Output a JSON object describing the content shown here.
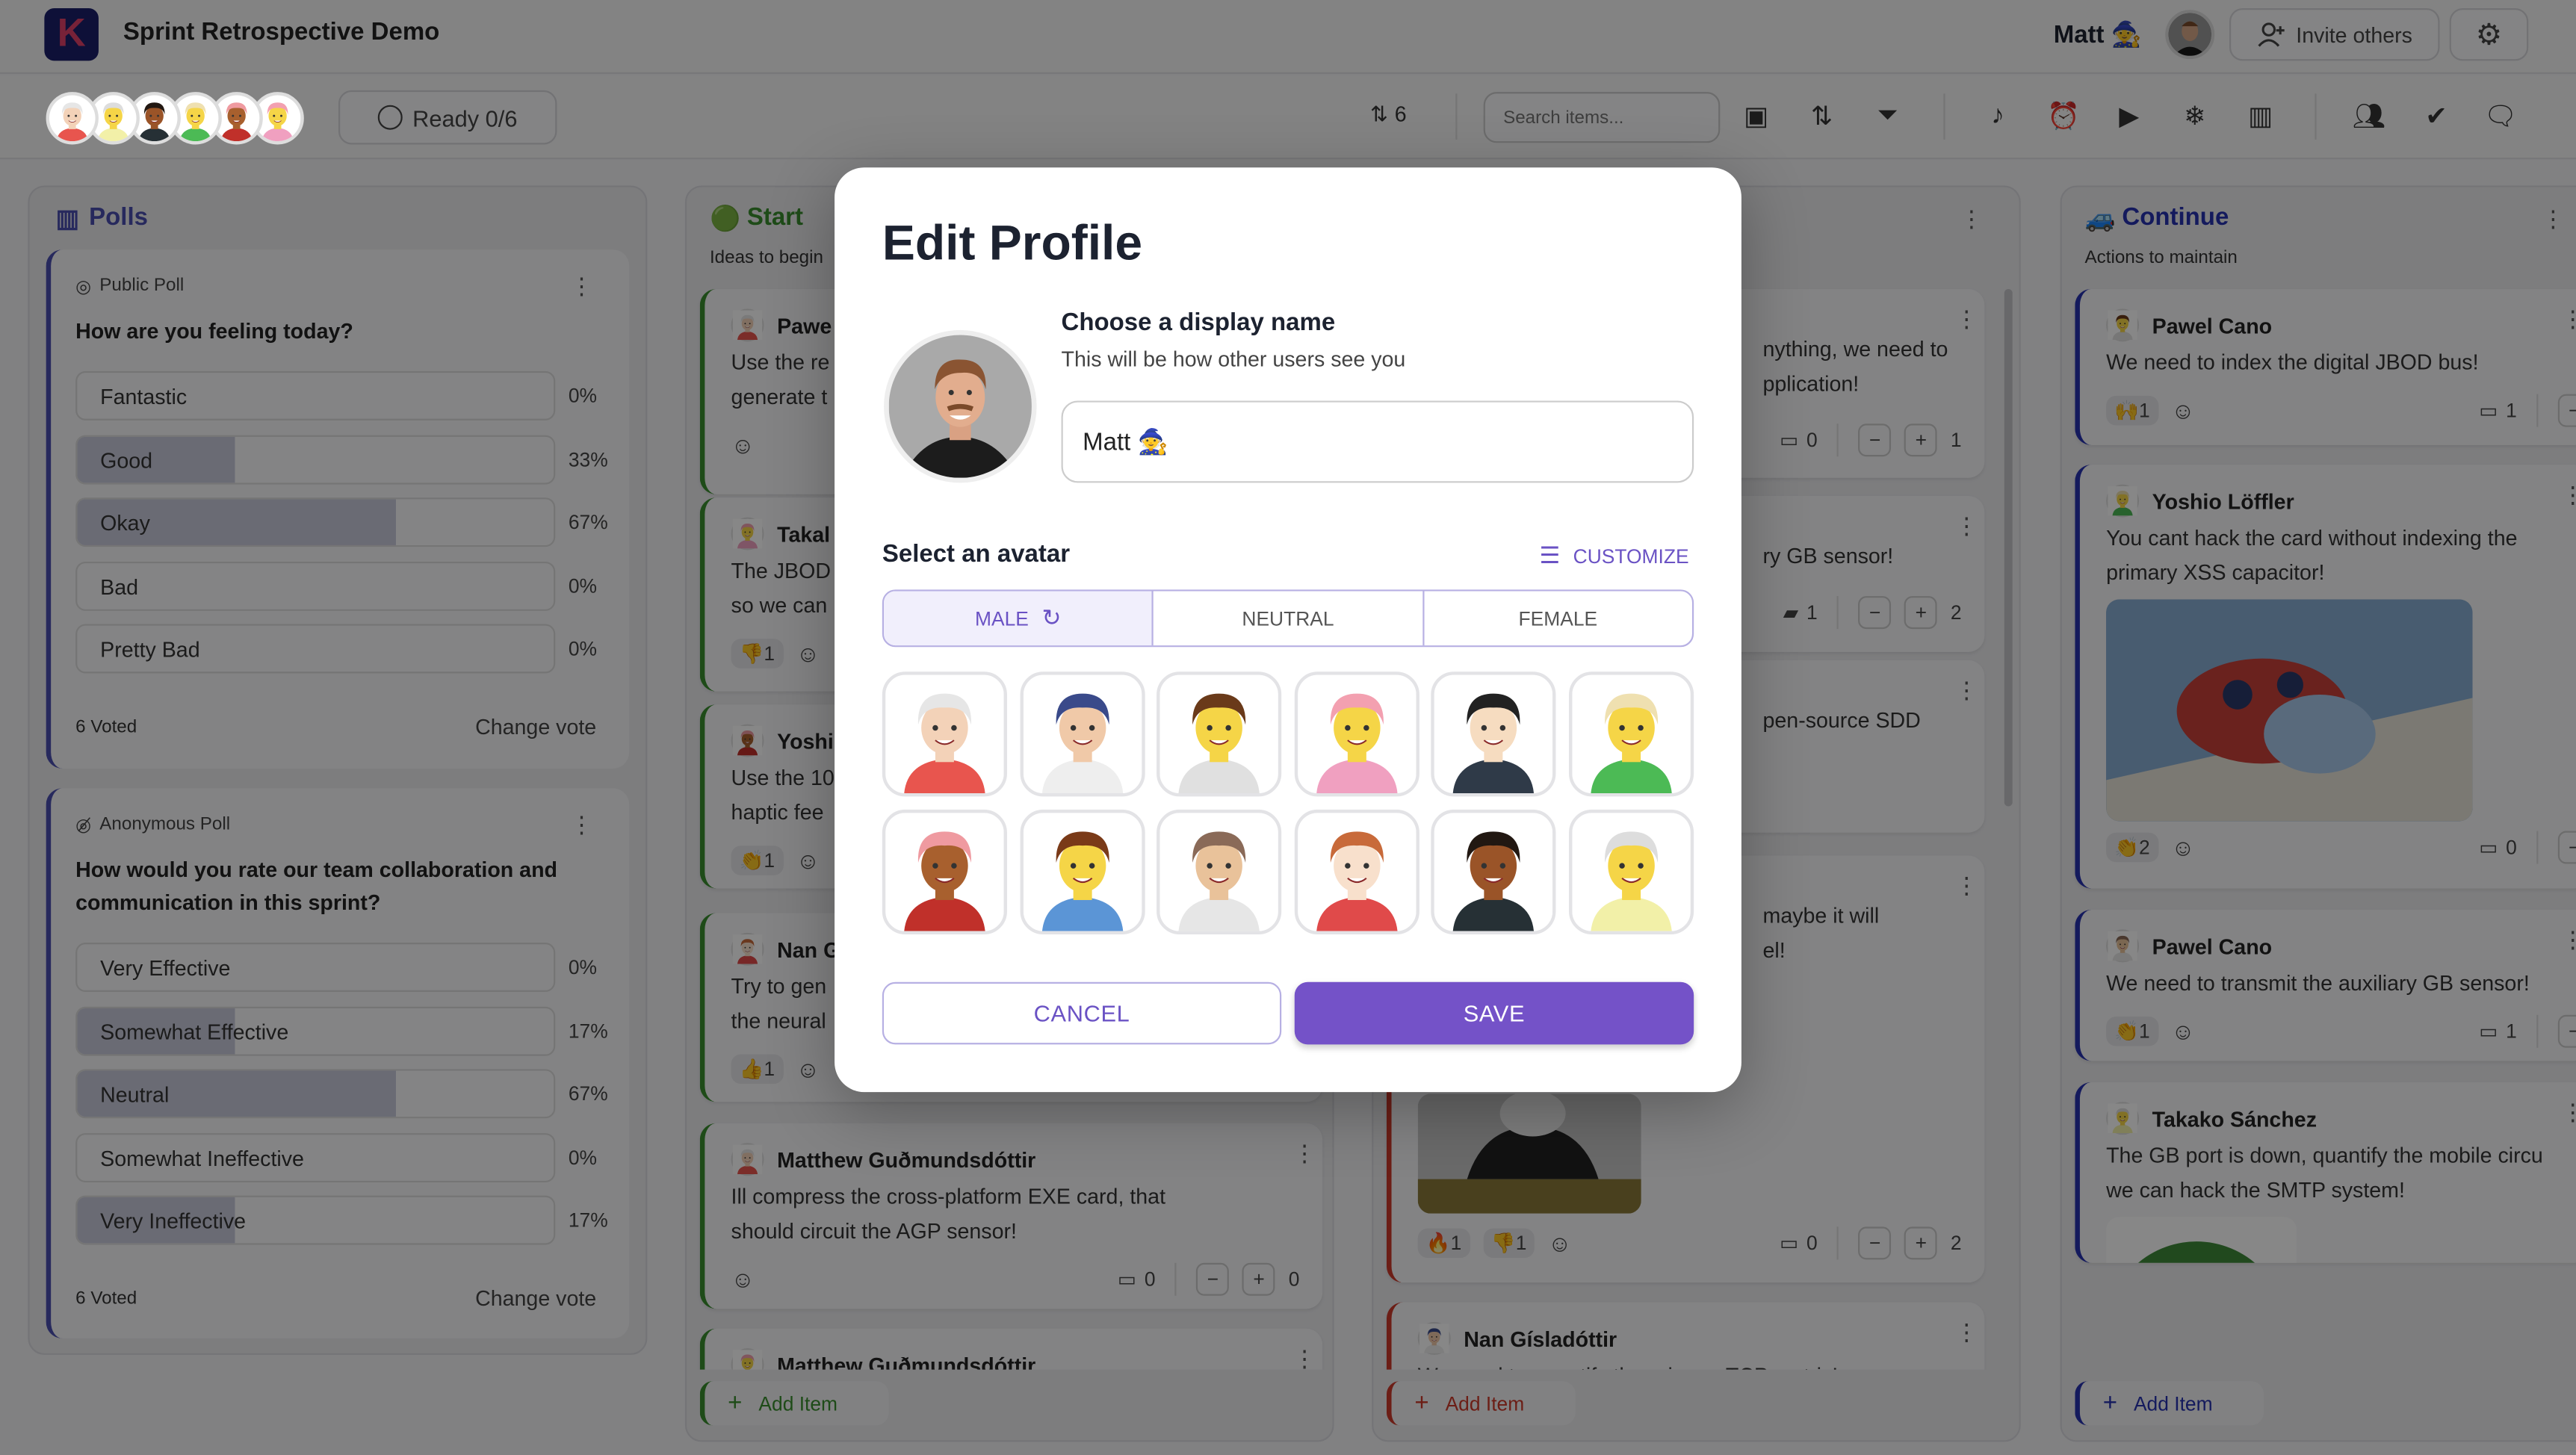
{
  "app": {
    "title": "Sprint Retrospective Demo",
    "logo_letter": "K",
    "user_name": "Matt 🧙",
    "invite_label": "Invite others"
  },
  "toolbar": {
    "ready_label": "Ready 0/6",
    "votes_left": "6",
    "search_placeholder": "Search items...",
    "participant_count": 6
  },
  "colors": {
    "accent": "#7452c8",
    "start": "#3a8f2e",
    "stop": "#cc3a2a",
    "continue": "#2632b0",
    "polls": "#4a4fb0"
  },
  "polls": {
    "title": "Polls",
    "items": [
      {
        "type": "Public Poll",
        "question": "How are you feeling today?",
        "options": [
          {
            "label": "Fantastic",
            "pct": "0%",
            "value": 0
          },
          {
            "label": "Good",
            "pct": "33%",
            "value": 33
          },
          {
            "label": "Okay",
            "pct": "67%",
            "value": 67
          },
          {
            "label": "Bad",
            "pct": "0%",
            "value": 0
          },
          {
            "label": "Pretty Bad",
            "pct": "0%",
            "value": 0
          }
        ],
        "voted": "6 Voted",
        "change": "Change vote"
      },
      {
        "type": "Anonymous Poll",
        "question": "How would you rate our team collaboration and communication in this sprint?",
        "options": [
          {
            "label": "Very Effective",
            "pct": "0%",
            "value": 0
          },
          {
            "label": "Somewhat Effective",
            "pct": "17%",
            "value": 17
          },
          {
            "label": "Neutral",
            "pct": "67%",
            "value": 67
          },
          {
            "label": "Somewhat Ineffective",
            "pct": "0%",
            "value": 0
          },
          {
            "label": "Very Ineffective",
            "pct": "17%",
            "value": 17
          }
        ],
        "voted": "6 Voted",
        "change": "Change vote"
      }
    ]
  },
  "columns": [
    {
      "id": "start",
      "emoji": "🟢",
      "title": "Start",
      "subtitle": "Ideas to begin",
      "add_label": "Add Item",
      "cards": [
        {
          "author": "Pawe",
          "text": [
            "Use the re",
            "generate t"
          ],
          "reactions": []
        },
        {
          "author": "Takal",
          "text": [
            "The JBOD",
            "so we can"
          ],
          "reactions": [
            {
              "emoji": "👎",
              "count": "1"
            }
          ]
        },
        {
          "author": "Yoshi",
          "text": [
            "Use the 10",
            "haptic fee"
          ],
          "reactions": [
            {
              "emoji": "👏",
              "count": "1"
            }
          ]
        },
        {
          "author": "Nan G",
          "text": [
            "Try to gen",
            "the neural"
          ],
          "reactions": [
            {
              "emoji": "👍",
              "count": "1"
            }
          ]
        },
        {
          "author": "Matthew Guðmundsdóttir",
          "text": [
            "Ill compress the cross-platform EXE card, that",
            "should circuit the AGP sensor!"
          ],
          "reactions": [],
          "comments": "0",
          "votes": "0"
        },
        {
          "author": "Matthew Guðmundsdóttir",
          "text": [],
          "reactions": []
        }
      ]
    },
    {
      "id": "stop",
      "emoji": "",
      "title": "",
      "subtitle": "",
      "add_label": "Add Item",
      "cards": [
        {
          "author": "",
          "text": [
            "nything, we need to",
            "pplication!"
          ],
          "reactions": [],
          "comments": "0",
          "votes": "1"
        },
        {
          "author": "",
          "text": [
            "ry GB sensor!"
          ],
          "reactions": [],
          "comments": "1",
          "comment_filled": true,
          "votes": "2"
        },
        {
          "author": "",
          "text": [
            "pen-source SDD"
          ],
          "reactions": []
        },
        {
          "author": "",
          "text": [
            "maybe it will",
            "el!"
          ],
          "reactions": [
            {
              "emoji": "🔥",
              "count": "1"
            },
            {
              "emoji": "👎",
              "count": "1"
            }
          ],
          "comments": "0",
          "votes": "2",
          "image": "gif"
        },
        {
          "author": "Nan Gísladóttir",
          "text": [
            "We need to quantify the primary TCP matrix!"
          ],
          "reactions": []
        }
      ]
    },
    {
      "id": "continue",
      "emoji": "🚙",
      "title": "Continue",
      "subtitle": "Actions to maintain",
      "add_label": "Add Item",
      "cards": [
        {
          "author": "Pawel Cano",
          "text": [
            "We need to index the digital JBOD bus!"
          ],
          "reactions": [
            {
              "emoji": "🙌",
              "count": "1"
            }
          ],
          "comments": "1"
        },
        {
          "author": "Yoshio Löffler",
          "text": [
            "You cant hack the card without indexing the",
            "primary XSS capacitor!"
          ],
          "reactions": [
            {
              "emoji": "👏",
              "count": "2"
            }
          ],
          "comments": "0",
          "image": "ladybug"
        },
        {
          "author": "Pawel Cano",
          "text": [
            "We need to transmit the auxiliary GB sensor!"
          ],
          "reactions": [
            {
              "emoji": "👏",
              "count": "1"
            }
          ],
          "comments": "1"
        },
        {
          "author": "Takako Sánchez",
          "text": [
            "The GB port is down, quantify the mobile circu",
            "we can hack the SMTP system!"
          ],
          "reactions": [],
          "image": "frog"
        }
      ]
    }
  ],
  "modal": {
    "title": "Edit Profile",
    "name_heading": "Choose a display name",
    "name_hint": "This will be how other users see you",
    "name_value": "Matt 🧙",
    "avatar_heading": "Select an avatar",
    "customize_label": "CUSTOMIZE",
    "tabs": [
      {
        "label": "MALE",
        "selected": true
      },
      {
        "label": "NEUTRAL"
      },
      {
        "label": "FEMALE"
      }
    ],
    "avatars": [
      {
        "skin": "#f3d2b8",
        "hair": "#e6e6e6",
        "shirt": "#e8554e"
      },
      {
        "skin": "#f0c9a8",
        "hair": "#3a4a8a",
        "shirt": "#eeeeee"
      },
      {
        "skin": "#f5d547",
        "hair": "#6a3a1a",
        "shirt": "#e0e0e0"
      },
      {
        "skin": "#f5d547",
        "hair": "#f3a0b0",
        "shirt": "#f0a0c0"
      },
      {
        "skin": "#f6dcc0",
        "hair": "#222222",
        "shirt": "#2f3a48"
      },
      {
        "skin": "#f5d547",
        "hair": "#efe0b0",
        "shirt": "#4cba55"
      },
      {
        "skin": "#a8602e",
        "hair": "#ef9aa0",
        "shirt": "#c0302a"
      },
      {
        "skin": "#f5d547",
        "hair": "#7a3a18",
        "shirt": "#5b95d6"
      },
      {
        "skin": "#e9c29a",
        "hair": "#8a6a58",
        "shirt": "#e6e6e6"
      },
      {
        "skin": "#f8e0cc",
        "hair": "#c86a3a",
        "shirt": "#e04a4a"
      },
      {
        "skin": "#9a5428",
        "hair": "#221812",
        "shirt": "#263035"
      },
      {
        "skin": "#f5d547",
        "hair": "#dddddd",
        "shirt": "#f2f0a8"
      }
    ],
    "cancel_label": "CANCEL",
    "save_label": "SAVE"
  }
}
